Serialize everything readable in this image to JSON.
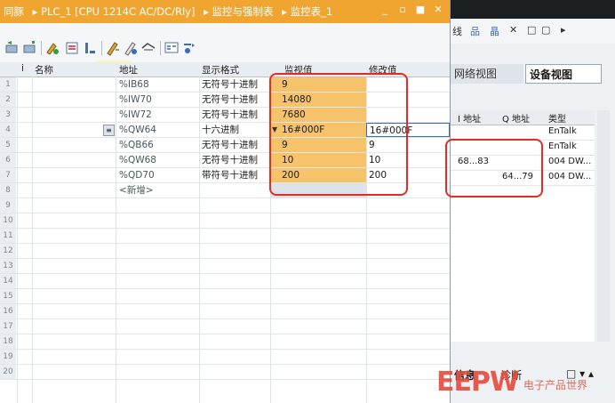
{
  "title": {
    "crumbs": [
      "同豚",
      "▸ PLC_1 [CPU 1214C AC/DC/Rly]",
      "▸ 监控与强制表",
      "▸ 监控表_1"
    ],
    "buttons": [
      "_",
      "▫",
      "■",
      "✕"
    ]
  },
  "grid": {
    "columns": [
      "i",
      "名称",
      "地址",
      "显示格式",
      "监视值",
      "修改值"
    ],
    "rows": [
      {
        "n": "1",
        "address": "%IB68",
        "format": "无符号十进制",
        "monitor": "9",
        "modify": ""
      },
      {
        "n": "2",
        "address": "%IW70",
        "format": "无符号十进制",
        "monitor": "14080",
        "modify": ""
      },
      {
        "n": "3",
        "address": "%IW72",
        "format": "无符号十进制",
        "monitor": "7680",
        "modify": ""
      },
      {
        "n": "4",
        "address": "%QW64",
        "format": "十六进制",
        "monitor": "16#000F",
        "modify": "16#000F"
      },
      {
        "n": "5",
        "address": "%QB66",
        "format": "无符号十进制",
        "monitor": "9",
        "modify": "9"
      },
      {
        "n": "6",
        "address": "%QW68",
        "format": "无符号十进制",
        "monitor": "10",
        "modify": "10"
      },
      {
        "n": "7",
        "address": "%QD70",
        "format": "带符号十进制",
        "monitor": "200",
        "modify": "200"
      },
      {
        "n": "8",
        "address": "<新增>",
        "format": "",
        "monitor": "",
        "modify": ""
      }
    ],
    "blank_rows": [
      "9",
      "10",
      "11",
      "12",
      "13",
      "14",
      "15",
      "16",
      "17",
      "18",
      "19",
      "20"
    ]
  },
  "right": {
    "toolbar": [
      "线",
      "品",
      "晶",
      "✕",
      "□",
      "▢",
      "▸"
    ],
    "tabs": [
      "网络视图",
      "设备视图"
    ],
    "columns": [
      "I 地址",
      "Q 地址",
      "类型"
    ],
    "rows": [
      {
        "i": "",
        "q": "",
        "type": "EnTalk"
      },
      {
        "i": "",
        "q": "",
        "type": "EnTalk"
      },
      {
        "i": "68...83",
        "q": "",
        "type": "004 DW..."
      },
      {
        "i": "",
        "q": "64...79",
        "type": "004 DW..."
      }
    ],
    "bottom_tabs": [
      "信息",
      "诊断"
    ],
    "bottom_icons": "□ ▾ ▴"
  },
  "watermark": {
    "logo": "EEPW",
    "text": "电子产品世界"
  },
  "colors": {
    "accent": "#f0a530",
    "monitor_cell": "#f7c36a",
    "highlight_box": "#e52b22"
  }
}
